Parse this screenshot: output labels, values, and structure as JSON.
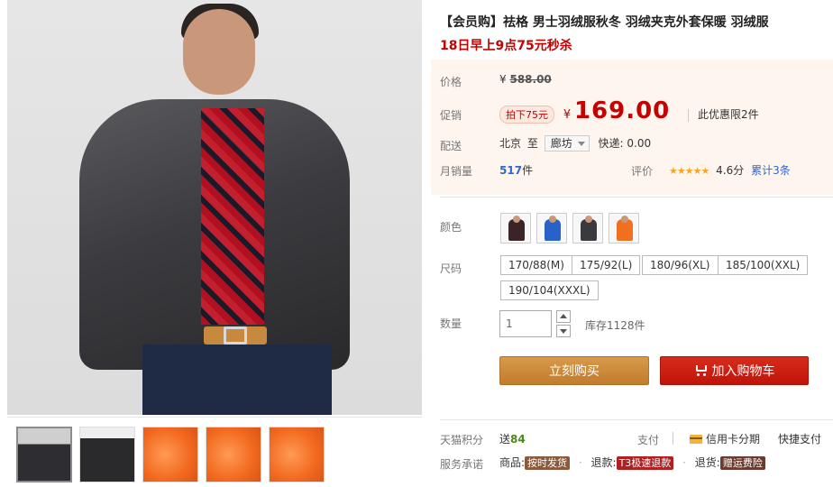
{
  "product": {
    "title": "【会员购】祛格 男士羽绒服秋冬 羽绒夹克外套保暖 羽绒服",
    "promo": "18日早上9点75元秒杀"
  },
  "price": {
    "label": "价格",
    "yen": "¥",
    "original": "588.00"
  },
  "sale": {
    "label": "促销",
    "pill": "拍下75元",
    "yen": "¥",
    "price": "169.00",
    "limit": "此优惠限2件"
  },
  "shipping": {
    "label": "配送",
    "from": "北京",
    "to_word": "至",
    "city": "廊坊",
    "express": "快递: 0.00"
  },
  "sales": {
    "label": "月销量",
    "count": "517",
    "unit": "件",
    "rating_label": "评价",
    "stars": "★★★★★",
    "score": "4.6分",
    "reviews": "累计3条"
  },
  "color": {
    "label": "颜色",
    "options": [
      {
        "name": "dark-red",
        "fig": "#3a2428"
      },
      {
        "name": "blue",
        "fig": "#2862c8"
      },
      {
        "name": "grey",
        "fig": "#3a3a3e"
      },
      {
        "name": "orange",
        "fig": "#f07020"
      }
    ]
  },
  "size": {
    "label": "尺码",
    "options": [
      "170/88(M)",
      "175/92(L)",
      "180/96(XL)",
      "185/100(XXL)",
      "190/104(XXXL)"
    ]
  },
  "quantity": {
    "label": "数量",
    "value": "1",
    "stock": "库存1128件"
  },
  "buttons": {
    "buy": "立刻购买",
    "cart": "加入购物车"
  },
  "points": {
    "label": "天猫积分",
    "send": "送",
    "value": "84",
    "pay_label": "支付",
    "credit": "信用卡分期",
    "fast": "快捷支付"
  },
  "service": {
    "label": "服务承诺",
    "goods": "商品:",
    "goods_tag": "按时发货",
    "refund": "退款:",
    "refund_tag": "T3极速退款",
    "return": "退货:",
    "return_tag": "赠运费险"
  },
  "colors": {
    "accent_red": "#c40000",
    "buy_button": "#c27c2c",
    "cart_button": "#c0140a",
    "link_blue": "#3366cc"
  }
}
